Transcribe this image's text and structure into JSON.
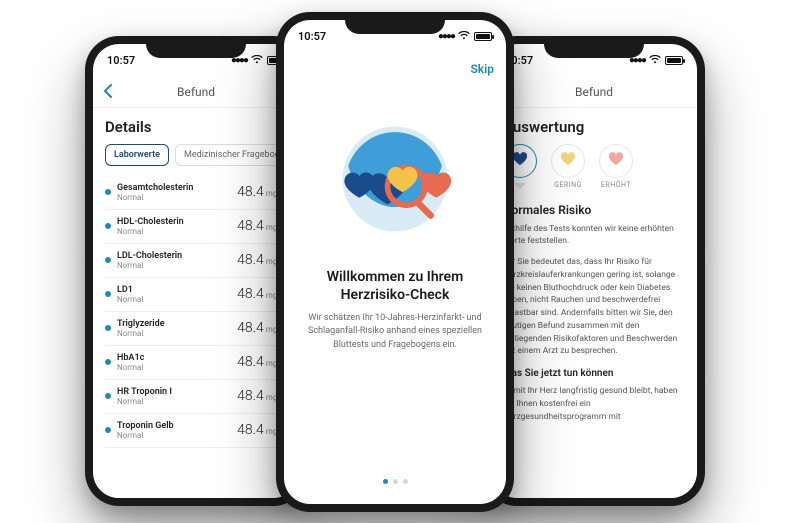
{
  "status": {
    "time": "10:57"
  },
  "left": {
    "nav_title": "Befund",
    "section": "Details",
    "tabs": {
      "active": "Laborwerte",
      "other": "Medizinischer Fragebogen"
    },
    "unit": "mg/dl",
    "rows": [
      {
        "name": "Gesamtcholesterin",
        "status": "Normal",
        "value": "48.4"
      },
      {
        "name": "HDL-Cholesterin",
        "status": "Normal",
        "value": "48.4"
      },
      {
        "name": "LDL-Cholesterin",
        "status": "Normal",
        "value": "48.4"
      },
      {
        "name": "LD1",
        "status": "Normal",
        "value": "48.4"
      },
      {
        "name": "Triglyzeride",
        "status": "Normal",
        "value": "48.4"
      },
      {
        "name": "HbA1c",
        "status": "Normal",
        "value": "48.4"
      },
      {
        "name": "HR Troponin I",
        "status": "Normal",
        "value": "48.4"
      },
      {
        "name": "Troponin Gelb",
        "status": "Normal",
        "value": "48.4"
      }
    ]
  },
  "center": {
    "skip": "Skip",
    "title": "Willkommen zu Ihrem Herzrisiko-Check",
    "desc": "Wir schätzen Ihr 10-Jahres-Herzinfarkt- und Schlaganfall-Risiko anhand eines speziellen Bluttests und Fragebogens ein."
  },
  "right": {
    "nav_title": "Befund",
    "section": "Auswertung",
    "badges": {
      "b1": "",
      "b2": "GERING",
      "b3": "ERHÖHT"
    },
    "risk_head": "Normales  Risiko",
    "p1": "Mithilfe des Tests konnten wir keine erhöhten Werte feststellen.",
    "p2": "Für Sie bedeutet das, dass Ihr Risiko für Herzkreislauferkrankungen gering ist, solange Sie keinen Bluthochdruck oder kein Diabetes haben, nicht Rauchen und beschwerdefrei belastbar sind. Andernfalls bitten wir Sie, den heutigen Befund zusammen mit den vorliegenden Risikofaktoren und Beschwerden mit einem Arzt zu besprechen.",
    "sub": "Was Sie jetzt tun können",
    "p3": "Damit Ihr Herz langfristig gesund bleibt, haben wir Ihnen kostenfrei ein Herzgesundheitsprogramm mit"
  }
}
